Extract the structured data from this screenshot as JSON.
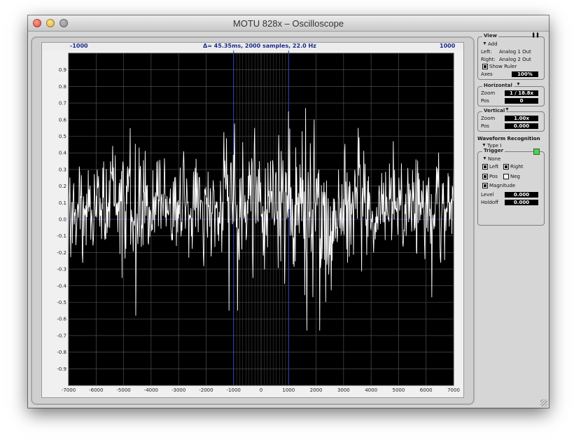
{
  "window": {
    "title": "MOTU 828x – Oscilloscope"
  },
  "ruler": {
    "left": "-1000",
    "center": "Δ= 45.35ms, 2000 samples, 22.0 Hz",
    "right": "1000"
  },
  "scope": {
    "y_ticks": [
      "0.9",
      "0.8",
      "0.7",
      "0.6",
      "0.5",
      "0.4",
      "0.3",
      "0.2",
      "0.1",
      "0.0",
      "-0.1",
      "-0.2",
      "-0.3",
      "-0.4",
      "-0.5",
      "-0.6",
      "-0.7",
      "-0.8",
      "-0.9"
    ],
    "x_ticks": [
      "-7000",
      "-6000",
      "-5000",
      "-4000",
      "-3000",
      "-2000",
      "-1000",
      "0",
      "1000",
      "2000",
      "3000",
      "4000",
      "5000",
      "6000",
      "7000"
    ],
    "x_range": [
      -7000,
      7000
    ],
    "y_range": [
      -1,
      1
    ],
    "ruler_markers": [
      -1000,
      1000
    ],
    "colors": {
      "background": "#000000",
      "grid": "#5a5a5a",
      "trace": "#ffffff",
      "ruler": "#3048c8"
    }
  },
  "view": {
    "title": "View",
    "add": "Add",
    "left_label": "Left:",
    "left_value": "Analog 1 Out",
    "right_label": "Right:",
    "right_value": "Analog 2 Out",
    "show_ruler": "Show Ruler",
    "axes_label": "Axes",
    "axes_value": "100%"
  },
  "horizontal": {
    "title": "Horizontal",
    "zoom_label": "Zoom",
    "zoom_value": "1 / 18.8x",
    "pos_label": "Pos",
    "pos_value": "0"
  },
  "vertical": {
    "title": "Vertical",
    "zoom_label": "Zoom",
    "zoom_value": "1.00x",
    "pos_label": "Pos",
    "pos_value": "0.000"
  },
  "waveform": {
    "title": "Waveform Recognition",
    "type": "Type I"
  },
  "trigger": {
    "title": "Trigger",
    "mode": "None",
    "left": "Left",
    "right": "Right",
    "pos": "Pos",
    "neg": "Neg",
    "magnitude": "Magnitude",
    "level_label": "Level",
    "level_value": "0.000",
    "holdoff_label": "Holdoff",
    "holdoff_value": "0.000"
  }
}
